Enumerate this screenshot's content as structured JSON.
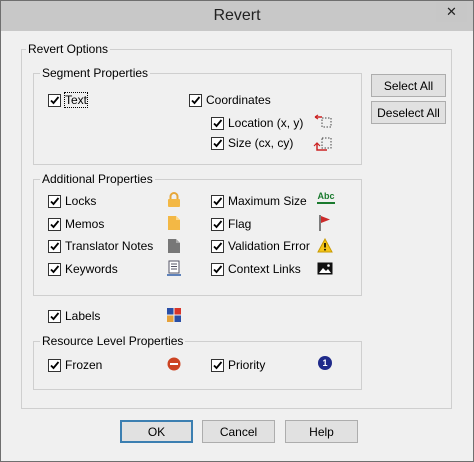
{
  "window": {
    "title": "Revert"
  },
  "groups": {
    "revert_options": "Revert Options",
    "segment": "Segment Properties",
    "additional": "Additional Properties",
    "resource": "Resource Level Properties"
  },
  "checks": {
    "text": "Text",
    "coordinates": "Coordinates",
    "location": "Location (x, y)",
    "size": "Size (cx, cy)",
    "locks": "Locks",
    "memos": "Memos",
    "translator_notes": "Translator Notes",
    "keywords": "Keywords",
    "maximum_size": "Maximum Size",
    "flag": "Flag",
    "validation_error": "Validation Error",
    "context_links": "Context Links",
    "labels": "Labels",
    "frozen": "Frozen",
    "priority": "Priority"
  },
  "buttons": {
    "select_all": "Select All",
    "deselect_all": "Deselect All",
    "ok": "OK",
    "cancel": "Cancel",
    "help": "Help"
  },
  "icons": {
    "max_size_text": "Abc",
    "priority_number": "1"
  }
}
